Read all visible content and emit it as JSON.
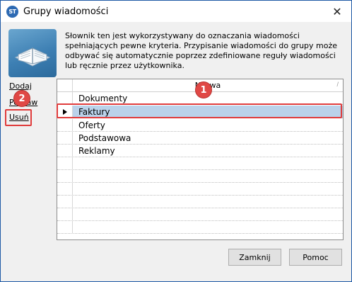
{
  "window": {
    "title": "Grupy wiadomości",
    "app_icon_text": "ST",
    "close_glyph": "✕"
  },
  "description": "Słownik ten jest wykorzystywany do oznaczania wiadomości spełniających pewne kryteria. Przypisanie wiadomości do grupy może odbywać się automatycznie poprzez zdefiniowane reguły wiadomości lub ręcznie przez użytkownika.",
  "sidebar": {
    "add_label": "Dodaj",
    "edit_label": "Popraw",
    "delete_label": "Usuń"
  },
  "grid": {
    "column_header": "Nazwa",
    "sort_glyph": "/",
    "rows": [
      "Dokumenty",
      "Faktury",
      "Oferty",
      "Podstawowa",
      "Reklamy"
    ],
    "selected_index": 1
  },
  "annotations": {
    "badge_1": "1",
    "badge_2": "2",
    "highlight_color": "#e03c3c"
  },
  "buttons": {
    "close_label": "Zamknij",
    "help_label": "Pomoc"
  },
  "icons": {
    "app": "app-logo-icon",
    "header": "dictionary-book-icon",
    "row_pointer": "row-pointer-icon"
  }
}
